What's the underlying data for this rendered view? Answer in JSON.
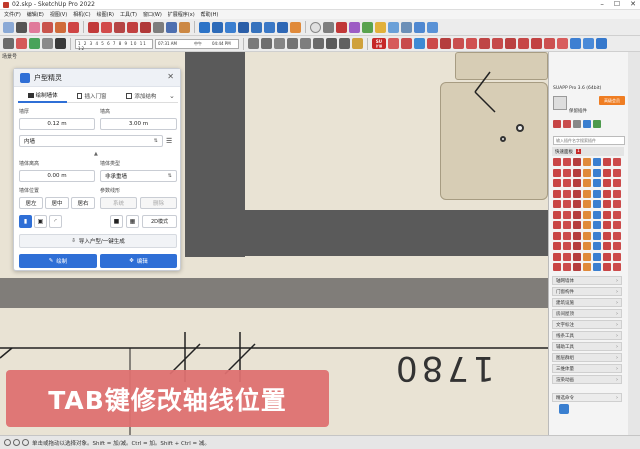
{
  "window": {
    "title": "02.skp - SketchUp Pro 2022",
    "min": "–",
    "max": "☐",
    "close": "✕"
  },
  "menu": [
    "文件(F)",
    "编辑(E)",
    "视图(V)",
    "相机(C)",
    "绘图(R)",
    "工具(T)",
    "窗口(W)",
    "扩展程序(x)",
    "帮助(H)"
  ],
  "toolbar": {
    "ruler_text": "1 2 3 4 5 6 7 8 9 10 11 12",
    "time_start": "07:31 AM",
    "time_noon": "中午",
    "time_end": "04:44 PM",
    "badge_su": "SU",
    "badge_su_sub": "扩展"
  },
  "scene_tab": "场景号",
  "panel": {
    "title": "户型精灵",
    "close": "✕",
    "tabs": [
      {
        "label": "绘制墙体",
        "icon": "wall-icon"
      },
      {
        "label": "插入门窗",
        "icon": "door-icon"
      },
      {
        "label": "添加结构",
        "icon": "structure-icon"
      }
    ],
    "more": "⌄",
    "wall_thickness_label": "墙厚",
    "wall_thickness_value": "0.12 m",
    "wall_height_label": "墙高",
    "wall_height_value": "3.00 m",
    "wall_type_value": "内墙",
    "wall_offset_label": "墙体离高",
    "wall_offset_value": "0.00 m",
    "wall_kind_label": "墙体类型",
    "wall_kind_value": "非承重墙",
    "axis_label": "墙体位置",
    "axis_buttons": [
      "居左",
      "居中",
      "居右"
    ],
    "ref_label": "参数线形",
    "ref_buttons": [
      "系统",
      "删除"
    ],
    "mode_2d": "2D模式",
    "import_label": "导入户型/一键生成",
    "draw_label": "绘制",
    "edit_label": "编辑",
    "accent_color": "#2f6fd6"
  },
  "sidebar": {
    "title": "SUAPP Pro 3.6 (64bit)",
    "badge": "高级会员",
    "user": "保留插件",
    "search_placeholder": "输入插件名字搜索插件",
    "quick_label": "快速面板",
    "quick_count": "1",
    "categories": [
      "轴网墙体",
      "门窗构件",
      "建筑设施",
      "房间屋顶",
      "文字标注",
      "线条工具",
      "辅助工具",
      "图层群组",
      "三维体量",
      "渲染动画"
    ],
    "bottom_label": "精选命令"
  },
  "caption": "TAB键修改轴线位置",
  "status": {
    "text": "单击或拖动以选择对象。Shift = 加/减。Ctrl = 加。Shift + Ctrl = 减。"
  },
  "dimension_text": "1780"
}
